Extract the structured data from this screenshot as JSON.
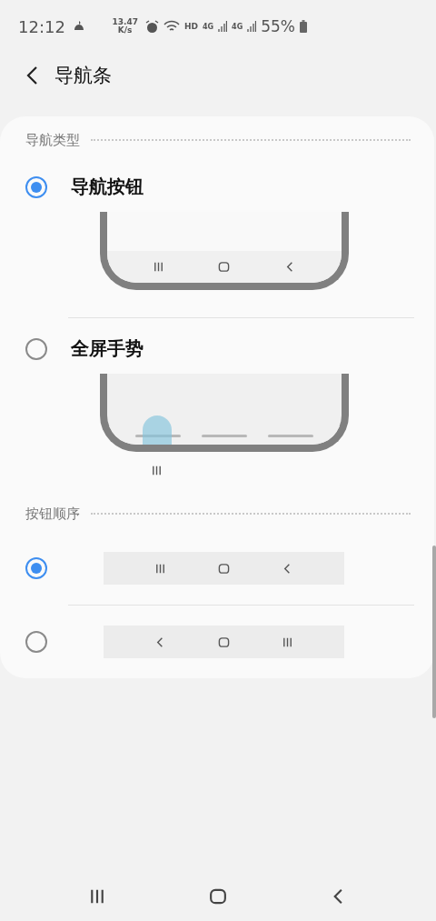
{
  "status_bar": {
    "time": "12:12",
    "speed_value": "13.47",
    "speed_unit": "K/s",
    "hd": "HD",
    "sims": [
      "4G",
      "4G"
    ],
    "battery": "55%"
  },
  "header": {
    "title": "导航条"
  },
  "sections": [
    {
      "title": "导航类型",
      "kind": "types",
      "options": [
        {
          "label": "导航按钮",
          "selected": true,
          "kind": "buttons"
        },
        {
          "label": "全屏手势",
          "selected": false,
          "kind": "gestures"
        }
      ]
    },
    {
      "title": "按钮顺序",
      "kind": "orders",
      "options": [
        {
          "selected": true,
          "keys": [
            {
              "kind": "recents"
            },
            {
              "kind": "home"
            },
            {
              "kind": "back"
            }
          ]
        },
        {
          "selected": false,
          "keys": [
            {
              "kind": "back"
            },
            {
              "kind": "home"
            },
            {
              "kind": "recents"
            }
          ]
        }
      ]
    }
  ],
  "nav_bar": {
    "keys": [
      {
        "kind": "recents"
      },
      {
        "kind": "home"
      },
      {
        "kind": "back"
      }
    ]
  }
}
